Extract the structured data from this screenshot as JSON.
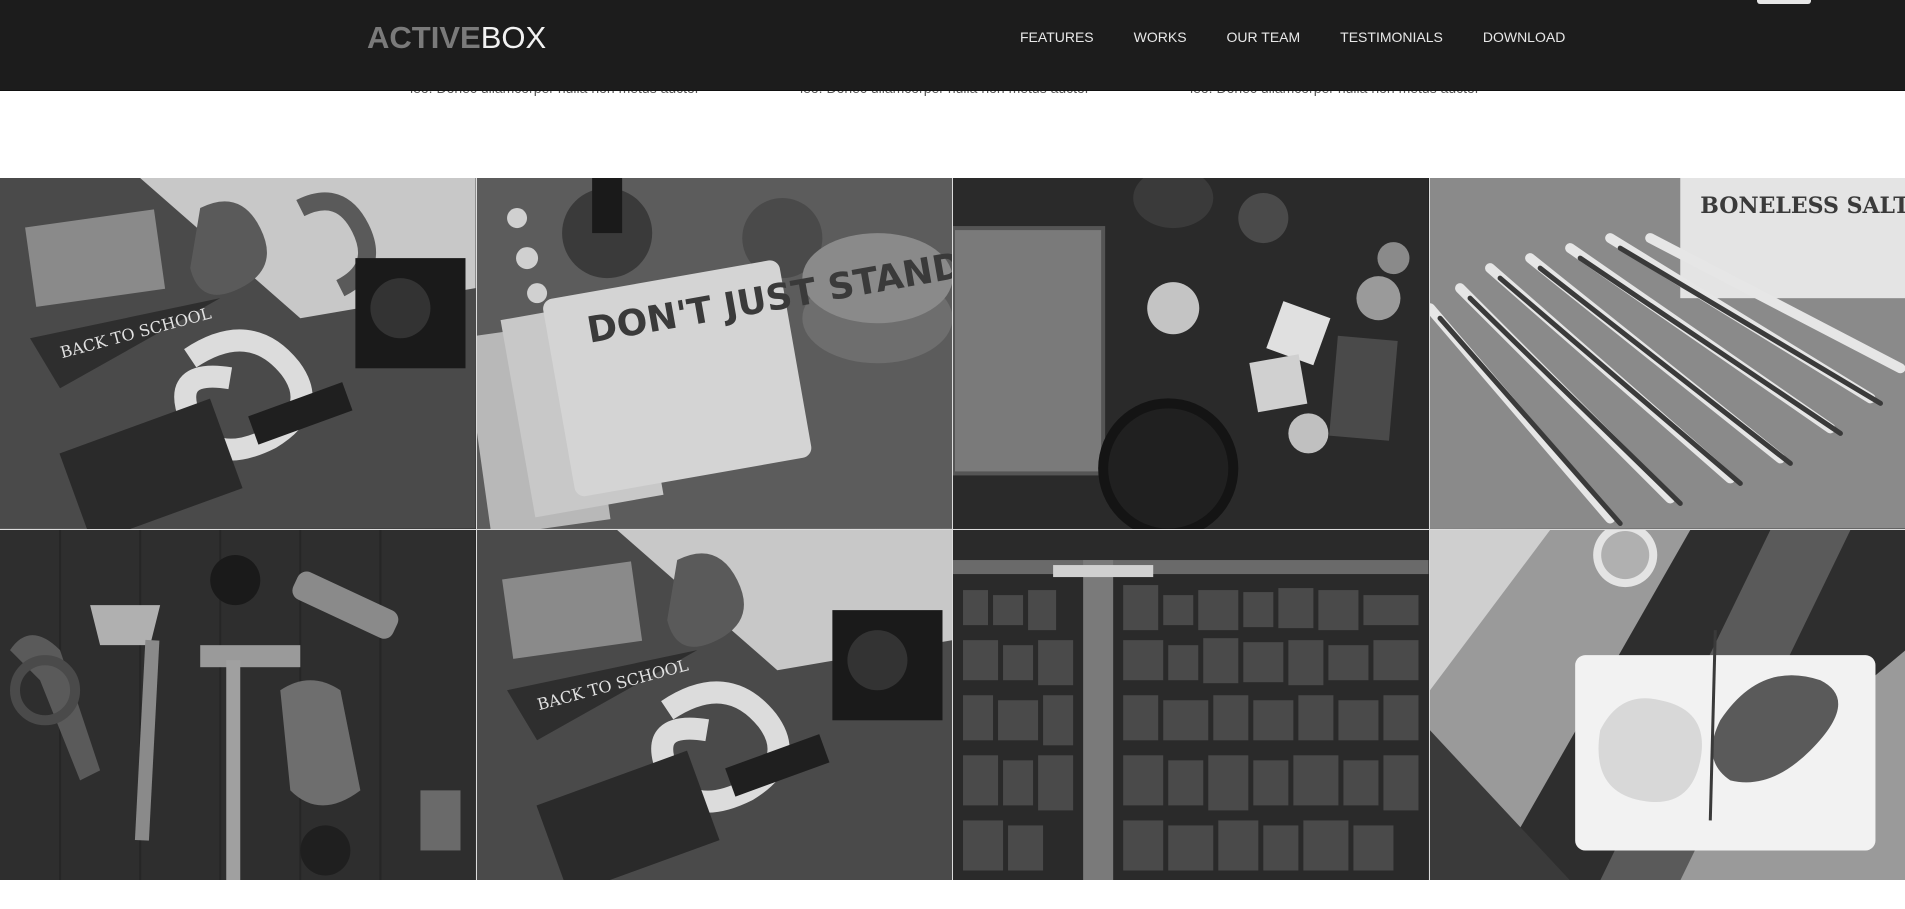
{
  "header": {
    "logo_bold": "ACTIVE",
    "logo_light": "BOX",
    "nav": [
      "FEATURES",
      "WORKS",
      "OUR TEAM",
      "TESTIMONIALS",
      "DOWNLOAD"
    ]
  },
  "features": {
    "snippets": [
      "leo. Donec ullamcorper nulla non metus auctor",
      "leo. Donec ullamcorper nulla non metus auctor",
      "leo. Donec ullamcorper nulla non metus auctor"
    ]
  },
  "gallery": {
    "tiles": [
      {
        "subject": "desk-with-typography-items"
      },
      {
        "subject": "dont-just-stand-there-notebooks"
      },
      {
        "subject": "kitchen-table-with-spices"
      },
      {
        "subject": "rulers-and-codfish-sign"
      },
      {
        "subject": "tools-on-wood"
      },
      {
        "subject": "desk-with-typography-items"
      },
      {
        "subject": "letterpress-wood-type"
      },
      {
        "subject": "plate-of-food-on-wood"
      }
    ],
    "image_texts": {
      "pennant": "BACK TO SCHOOL",
      "notebook": "DON'T JUST STAND THERE",
      "sign": "BONELESS SALT CODFISH FIRST NATIONAL STORES"
    }
  },
  "colors": {
    "navbar_bg": "#1c1c1c",
    "nav_text": "#e8e8e8",
    "logo_bold": "#7a7a7a",
    "logo_light": "#f2f2f2"
  }
}
